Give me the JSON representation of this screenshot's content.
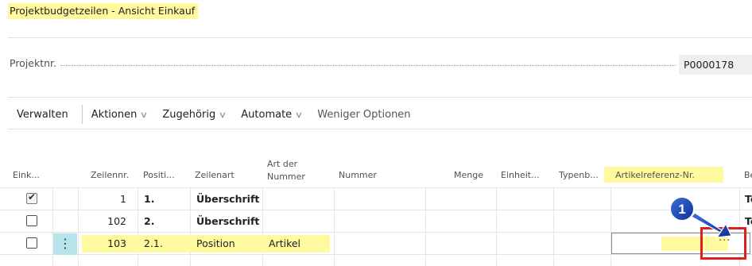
{
  "page": {
    "title": "Projektbudgetzeilen - Ansicht Einkauf"
  },
  "field": {
    "label": "Projektnr.",
    "value": "P0000178"
  },
  "actions": {
    "manage": "Verwalten",
    "actions": "Aktionen",
    "related": "Zugehörig",
    "automate": "Automate",
    "fewer_options": "Weniger Optionen"
  },
  "columns": {
    "purchase": "Eink...",
    "line_no": "Zeilennr.",
    "position": "Positi...",
    "line_type": "Zeilenart",
    "no_type_1": "Art der",
    "no_type_2": "Nummer",
    "number": "Nummer",
    "quantity": "Menge",
    "unit": "Einheit...",
    "type_code": "Typenb...",
    "item_ref": "Artikelreferenz-Nr.",
    "be": "Be"
  },
  "rows": [
    {
      "checked": true,
      "line_no": "1",
      "position": "1.",
      "line_type": "Überschrift",
      "no_type": "",
      "trail": "Te"
    },
    {
      "checked": false,
      "line_no": "102",
      "position": "2.",
      "line_type": "Überschrift",
      "no_type": "",
      "trail": "Te"
    },
    {
      "checked": false,
      "line_no": "103",
      "position": "2.1.",
      "line_type": "Position",
      "no_type": "Artikel",
      "trail": ""
    }
  ],
  "row_menu_glyph": "⋮",
  "ellipsis_glyph": "···",
  "callout": {
    "number": "1"
  },
  "colors": {
    "highlight": "#fffa9e",
    "callout_blue": "#1a3fa8",
    "callout_red": "#e02020",
    "row_menu": "#b7e3ea"
  }
}
